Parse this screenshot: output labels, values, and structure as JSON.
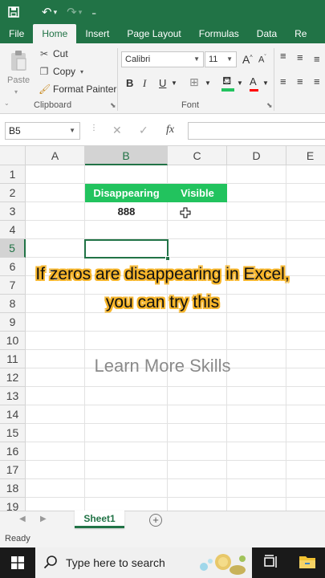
{
  "quick_access": {
    "save_icon": "save-icon",
    "undo_icon": "undo-icon",
    "redo_icon": "redo-icon",
    "customize_icon": "customize-icon"
  },
  "tabs": [
    "File",
    "Home",
    "Insert",
    "Page Layout",
    "Formulas",
    "Data",
    "Re"
  ],
  "ribbon": {
    "clipboard": {
      "paste": "Paste",
      "cut": "Cut",
      "copy": "Copy",
      "format_painter": "Format Painter",
      "group_label": "Clipboard"
    },
    "font": {
      "name": "Calibri",
      "size": "11",
      "grow": "A",
      "shrink": "A",
      "bold": "B",
      "italic": "I",
      "underline": "U",
      "font_color": "A",
      "group_label": "Font"
    }
  },
  "formula_bar": {
    "name_box": "B5",
    "cancel": "✕",
    "enter": "✓",
    "fx": "fx",
    "value": ""
  },
  "columns": [
    "A",
    "B",
    "C",
    "D",
    "E"
  ],
  "rows": [
    "1",
    "2",
    "3",
    "4",
    "5",
    "6",
    "7",
    "8",
    "9",
    "10",
    "11",
    "12",
    "13",
    "14",
    "15",
    "16",
    "17",
    "18",
    "19"
  ],
  "cells": {
    "B2": "Disappearing",
    "C2": "Visible",
    "B3": "888",
    "C3": ""
  },
  "selected_cell": "B5",
  "overlay": {
    "line1": "If zeros are disappearing in Excel,",
    "line2": "you can try this"
  },
  "watermark": "Learn More Skills",
  "sheets": [
    "Sheet1"
  ],
  "status": "Ready",
  "taskbar": {
    "search_placeholder": "Type here to search"
  },
  "colors": {
    "excel_green": "#217346",
    "header_fill": "#22c35e",
    "overlay_outline": "#f6b52a"
  }
}
